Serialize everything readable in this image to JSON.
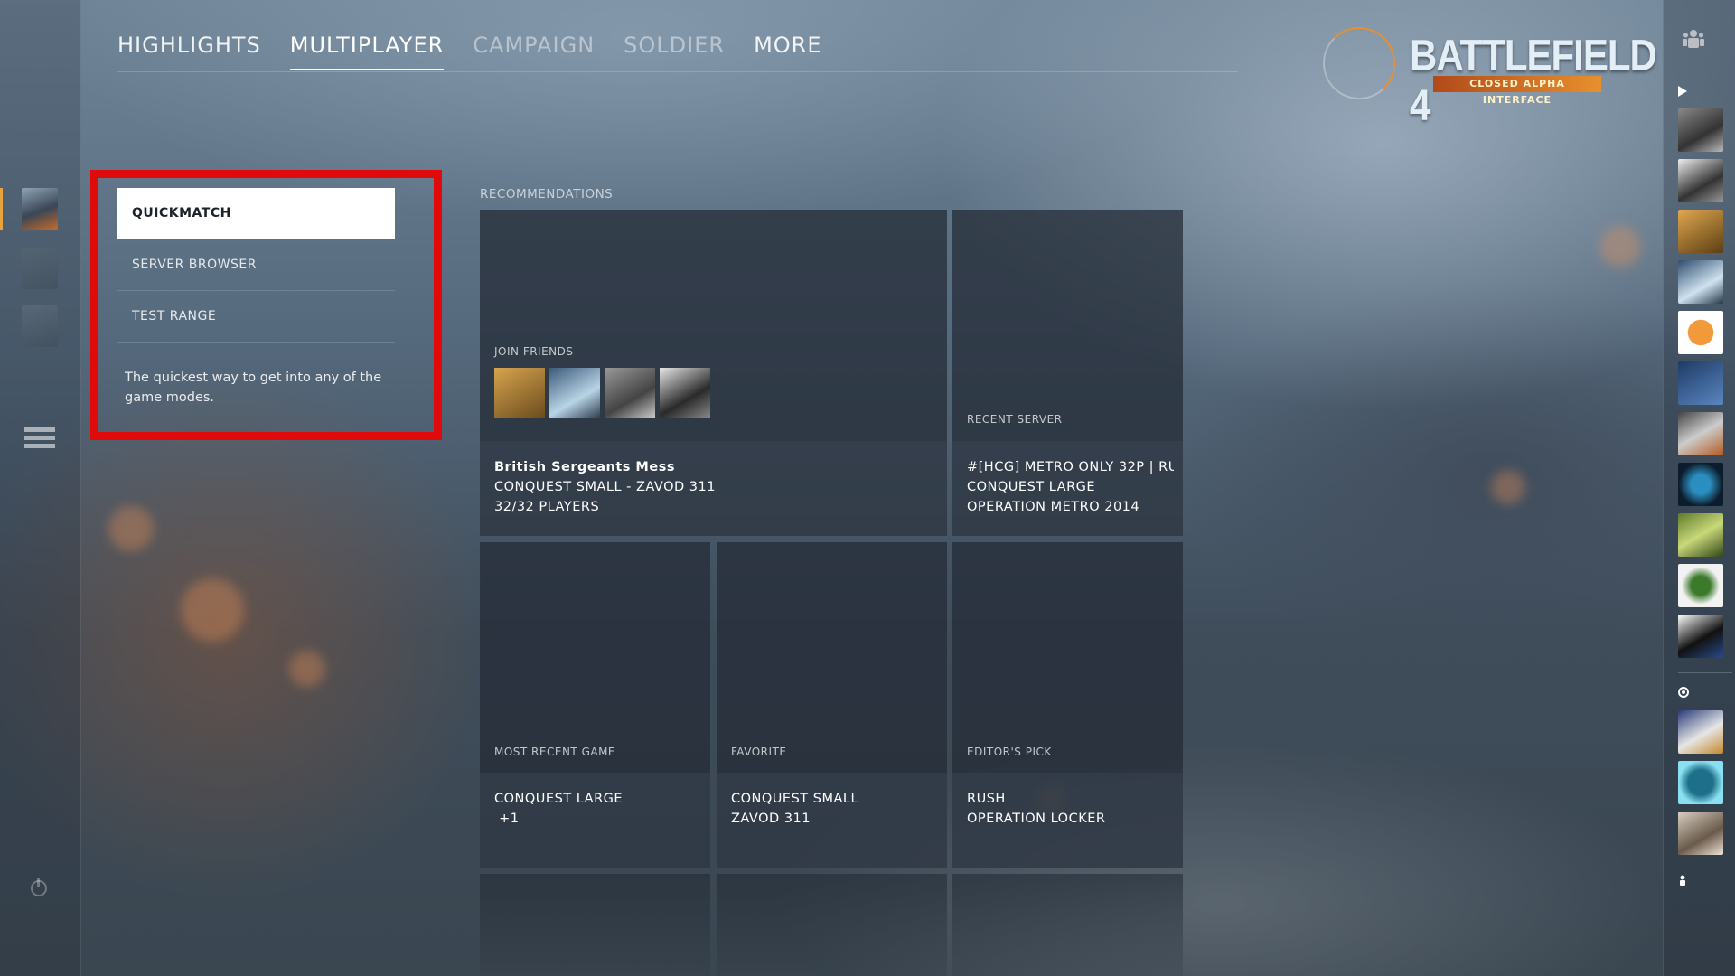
{
  "nav": {
    "items": [
      {
        "label": "HIGHLIGHTS",
        "state": "normal"
      },
      {
        "label": "MULTIPLAYER",
        "state": "active"
      },
      {
        "label": "CAMPAIGN",
        "state": "dim"
      },
      {
        "label": "SOLDIER",
        "state": "dim"
      },
      {
        "label": "MORE",
        "state": "normal"
      }
    ]
  },
  "logo": {
    "title": "BATTLEFIELD 4",
    "subtitle": "CLOSED ALPHA INTERFACE"
  },
  "submenu": {
    "items": [
      "QUICKMATCH",
      "SERVER BROWSER",
      "TEST RANGE"
    ],
    "description": "The quickest way to get into any of the game modes."
  },
  "recommendations": {
    "label": "RECOMMENDATIONS",
    "join_friends": {
      "category": "JOIN FRIENDS",
      "lines": [
        "British Sergeants Mess",
        "CONQUEST SMALL - ZAVOD 311",
        "32/32 PLAYERS"
      ]
    },
    "recent_server": {
      "category": "RECENT SERVER",
      "lines": [
        "#[HCG] METRO ONLY 32P | RU",
        "CONQUEST LARGE",
        "OPERATION METRO 2014"
      ]
    },
    "most_recent_game": {
      "category": "MOST RECENT GAME",
      "lines": [
        "CONQUEST LARGE",
        " +1"
      ]
    },
    "favorite": {
      "category": "FAVORITE",
      "lines": [
        "CONQUEST SMALL",
        "ZAVOD 311"
      ]
    },
    "editors_pick": {
      "category": "EDITOR'S PICK",
      "lines": [
        "RUSH",
        "OPERATION LOCKER"
      ]
    }
  },
  "colors": {
    "accent": "#e8902d",
    "highlight_box": "#e10a0a"
  }
}
